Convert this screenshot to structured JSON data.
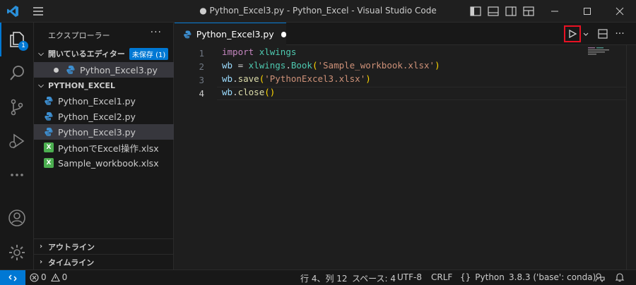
{
  "window": {
    "title": "● Python_Excel3.py - Python_Excel - Visual Studio Code"
  },
  "activity_bar": {
    "explorer_badge": "1"
  },
  "sidebar": {
    "header": "エクスプローラー",
    "more": "···",
    "open_editors": {
      "title": "開いているエディター",
      "unsaved_badge": "未保存 (1)",
      "items": [
        {
          "label": "Python_Excel3.py"
        }
      ]
    },
    "folder": {
      "title": "PYTHON_EXCEL",
      "items": [
        {
          "label": "Python_Excel1.py",
          "type": "py"
        },
        {
          "label": "Python_Excel2.py",
          "type": "py"
        },
        {
          "label": "Python_Excel3.py",
          "type": "py"
        },
        {
          "label": "PythonでExcel操作.xlsx",
          "type": "xlsx"
        },
        {
          "label": "Sample_workbook.xlsx",
          "type": "xlsx"
        }
      ]
    },
    "outline": "アウトライン",
    "timeline": "タイムライン"
  },
  "editor": {
    "tab_label": "Python_Excel3.py",
    "more": "···",
    "line_numbers": [
      "1",
      "2",
      "3",
      "4"
    ],
    "code": {
      "l1_kw": "import",
      "l1_mod": "xlwings",
      "l2_var": "wb",
      "l2_eq": " = ",
      "l2_mod": "xlwings",
      "l2_dot": ".",
      "l2_fn": "Book",
      "l2_open": "(",
      "l2_str": "'Sample_workbook.xlsx'",
      "l2_close": ")",
      "l3_var": "wb",
      "l3_dot": ".",
      "l3_fn": "save",
      "l3_open": "(",
      "l3_str": "'PythonExcel3.xlsx'",
      "l3_close": ")",
      "l4_var": "wb",
      "l4_dot": ".",
      "l4_fn": "close",
      "l4_parens": "()"
    }
  },
  "statusbar": {
    "errors": "0",
    "warnings": "0",
    "position": "行 4、列 12",
    "spaces": "スペース: 4",
    "encoding": "UTF-8",
    "eol": "CRLF",
    "language": "Python",
    "interpreter": "3.8.3 ('base': conda)"
  },
  "colors": {
    "accent": "#0078d4",
    "run_highlight": "#e81123"
  }
}
